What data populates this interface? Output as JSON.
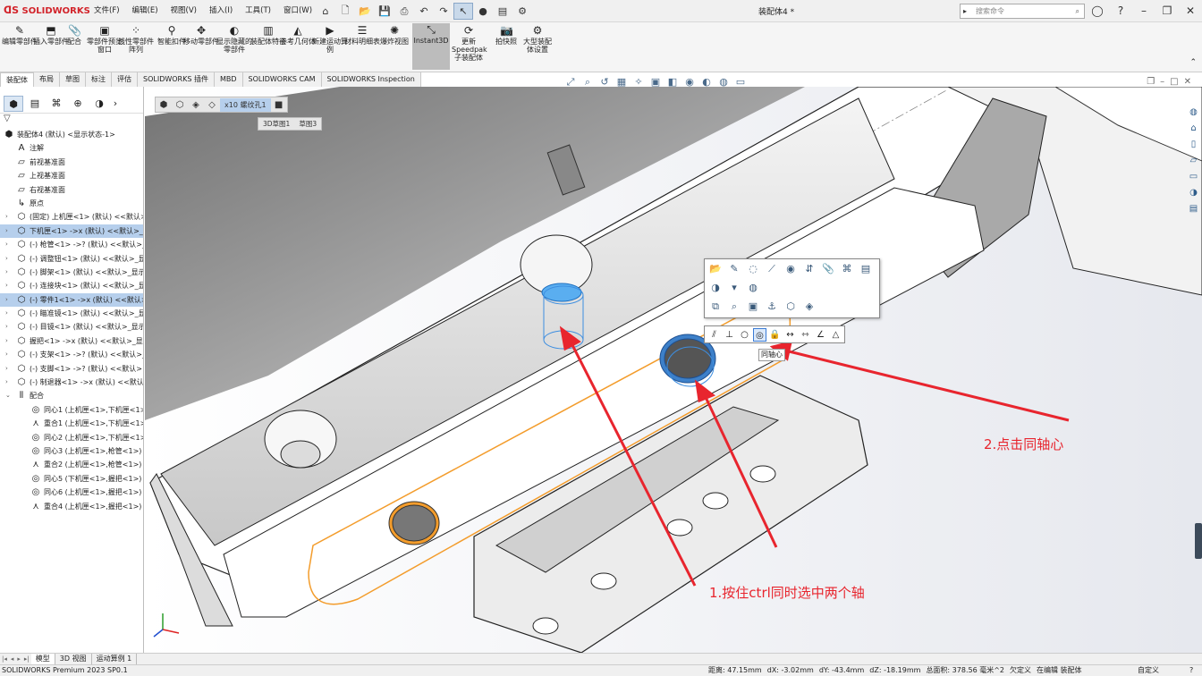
{
  "app": {
    "logo": "SOLIDWORKS",
    "doc_title": "装配体4 *"
  },
  "menu": [
    "文件(F)",
    "编辑(E)",
    "视图(V)",
    "插入(I)",
    "工具(T)",
    "窗口(W)"
  ],
  "search": {
    "placeholder": "搜索命令"
  },
  "ribbon": [
    {
      "label": "编辑零部件",
      "icon": "edit-component-icon"
    },
    {
      "label": "插入零部件",
      "icon": "insert-component-icon"
    },
    {
      "label": "配合",
      "icon": "mate-icon"
    },
    {
      "label": "零部件预览窗口",
      "icon": "preview-icon"
    },
    {
      "label": "线性零部件阵列",
      "icon": "pattern-icon"
    },
    {
      "label": "智能扣件",
      "icon": "fastener-icon"
    },
    {
      "label": "移动零部件",
      "icon": "move-icon"
    },
    {
      "label": "显示隐藏的零部件",
      "icon": "show-hidden-icon"
    },
    {
      "label": "装配体特征",
      "icon": "assembly-feature-icon"
    },
    {
      "label": "参考几何体",
      "icon": "reference-geometry-icon"
    },
    {
      "label": "新建运动算例",
      "icon": "motion-study-icon"
    },
    {
      "label": "材料明细表",
      "icon": "bom-icon"
    },
    {
      "label": "爆炸视图",
      "icon": "explode-icon"
    },
    {
      "label": "Instant3D",
      "icon": "instant3d-icon"
    },
    {
      "label": "更新Speedpak子装配体",
      "icon": "speedpak-icon"
    },
    {
      "label": "拍快照",
      "icon": "snapshot-icon"
    },
    {
      "label": "大型装配体设置",
      "icon": "large-assembly-icon"
    }
  ],
  "tabs": [
    "装配体",
    "布局",
    "草图",
    "标注",
    "评估",
    "SOLIDWORKS 插件",
    "MBD",
    "SOLIDWORKS CAM",
    "SOLIDWORKS Inspection"
  ],
  "tree": [
    {
      "label": "装配体4 (默认) <显示状态-1>",
      "level": 0,
      "icon": "assembly-icon",
      "hl": false,
      "exp": ""
    },
    {
      "label": "注解",
      "level": 1,
      "icon": "annotation-icon",
      "hl": false,
      "exp": ""
    },
    {
      "label": "前视基准面",
      "level": 1,
      "icon": "plane-icon",
      "hl": false,
      "exp": ""
    },
    {
      "label": "上视基准面",
      "level": 1,
      "icon": "plane-icon",
      "hl": false,
      "exp": ""
    },
    {
      "label": "右视基准面",
      "level": 1,
      "icon": "plane-icon",
      "hl": false,
      "exp": ""
    },
    {
      "label": "原点",
      "level": 1,
      "icon": "origin-icon",
      "hl": false,
      "exp": ""
    },
    {
      "label": "(固定) 上机匣<1> (默认) <<默认>",
      "level": 1,
      "icon": "part-icon",
      "hl": false,
      "exp": "›"
    },
    {
      "label": "下机匣<1> ->x (默认) <<默认>_显",
      "level": 1,
      "icon": "part-icon",
      "hl": true,
      "exp": "›"
    },
    {
      "label": "(-) 枪管<1> ->? (默认) <<默认>_",
      "level": 1,
      "icon": "part-icon",
      "hl": false,
      "exp": "›"
    },
    {
      "label": "(-) 调整钮<1> (默认) <<默认>_显",
      "level": 1,
      "icon": "part-icon",
      "hl": false,
      "exp": "›"
    },
    {
      "label": "(-) 脚架<1> (默认) <<默认>_显示",
      "level": 1,
      "icon": "part-icon",
      "hl": false,
      "exp": "›"
    },
    {
      "label": "(-) 连接块<1> (默认) <<默认>_显",
      "level": 1,
      "icon": "part-icon",
      "hl": false,
      "exp": "›"
    },
    {
      "label": "(-) 零件1<1> ->x (默认) <<默认>",
      "level": 1,
      "icon": "part-icon",
      "hl": true,
      "exp": "›"
    },
    {
      "label": "(-) 瞄准镜<1> (默认) <<默认>_显",
      "level": 1,
      "icon": "part-icon",
      "hl": false,
      "exp": "›"
    },
    {
      "label": "(-) 目镜<1> (默认) <<默认>_显示",
      "level": 1,
      "icon": "part-icon",
      "hl": false,
      "exp": "›"
    },
    {
      "label": "握把<1> ->x (默认) <<默认>_显示",
      "level": 1,
      "icon": "part-icon",
      "hl": false,
      "exp": "›"
    },
    {
      "label": "(-) 支架<1> ->? (默认) <<默认>_显",
      "level": 1,
      "icon": "part-icon",
      "hl": false,
      "exp": "›"
    },
    {
      "label": "(-) 支脚<1> ->? (默认) <<默认>",
      "level": 1,
      "icon": "part-icon",
      "hl": false,
      "exp": "›"
    },
    {
      "label": "(-) 制退器<1> ->x (默认) <<默认",
      "level": 1,
      "icon": "part-icon",
      "hl": false,
      "exp": "›"
    },
    {
      "label": "配合",
      "level": 1,
      "icon": "mates-folder-icon",
      "hl": false,
      "exp": "⌄"
    },
    {
      "label": "同心1 (上机匣<1>,下机匣<1>)",
      "level": 2,
      "icon": "concentric-icon",
      "hl": false,
      "exp": ""
    },
    {
      "label": "重合1 (上机匣<1>,下机匣<1>)",
      "level": 2,
      "icon": "coincident-icon",
      "hl": false,
      "exp": ""
    },
    {
      "label": "同心2 (上机匣<1>,下机匣<1>)",
      "level": 2,
      "icon": "concentric-icon",
      "hl": false,
      "exp": ""
    },
    {
      "label": "同心3 (上机匣<1>,枪管<1>)",
      "level": 2,
      "icon": "concentric-icon",
      "hl": false,
      "exp": ""
    },
    {
      "label": "重合2 (上机匣<1>,枪管<1>)",
      "level": 2,
      "icon": "coincident-icon",
      "hl": false,
      "exp": ""
    },
    {
      "label": "同心5 (下机匣<1>,握把<1>)",
      "level": 2,
      "icon": "concentric-icon",
      "hl": false,
      "exp": ""
    },
    {
      "label": "同心6 (上机匣<1>,握把<1>)",
      "level": 2,
      "icon": "concentric-icon",
      "hl": false,
      "exp": ""
    },
    {
      "label": "重合4 (上机匣<1>,握把<1>)",
      "level": 2,
      "icon": "coincident-icon",
      "hl": false,
      "exp": ""
    }
  ],
  "breadcrumb": {
    "item": "x10 螺纹孔1",
    "sub1": "3D草图1",
    "sub2": "草图3"
  },
  "tooltip": "同轴心",
  "annotations": {
    "step1": "1.按住ctrl同时选中两个轴",
    "step2": "2.点击同轴心"
  },
  "bottom_tabs": [
    "模型",
    "3D 视图",
    "运动算例 1"
  ],
  "status": {
    "app": "SOLIDWORKS Premium 2023 SP0.1",
    "distance": "距离: 47.15mm",
    "dx": "dX: -3.02mm",
    "dy": "dY: -43.4mm",
    "dz": "dZ: -18.19mm",
    "area": "总面积: 378.56 毫米^2",
    "underdef": "欠定义",
    "editing": "在编辑 装配体",
    "unit": "自定义"
  },
  "colors": {
    "accent_red": "#e8252e",
    "selection_orange": "#f39c2b",
    "highlight_blue": "#b6cfec"
  }
}
